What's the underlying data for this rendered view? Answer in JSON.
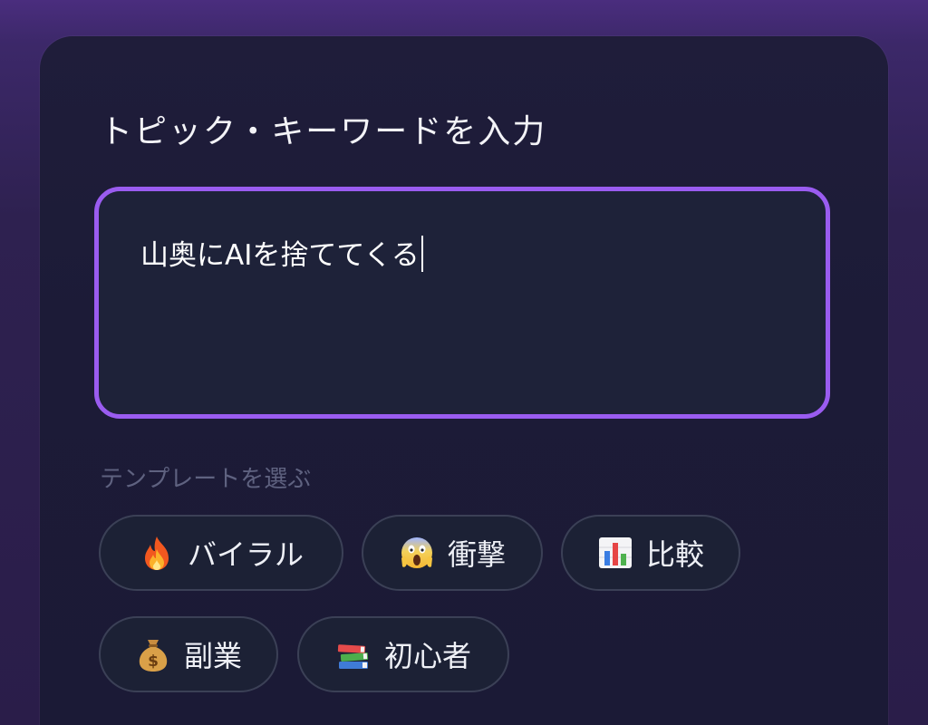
{
  "header": {
    "title": "トピック・キーワードを入力"
  },
  "topic_input": {
    "value": "山奥にAIを捨ててくる"
  },
  "templates": {
    "label": "テンプレートを選ぶ",
    "items": [
      {
        "label": "バイラル",
        "icon": "fire-icon"
      },
      {
        "label": "衝撃",
        "icon": "screaming-face-icon"
      },
      {
        "label": "比較",
        "icon": "bar-chart-icon"
      },
      {
        "label": "副業",
        "icon": "money-bag-icon"
      },
      {
        "label": "初心者",
        "icon": "books-icon"
      }
    ]
  },
  "colors": {
    "accent": "#9a5cf0",
    "card_background": "#1c1b37",
    "chip_border": "#3b4056"
  }
}
